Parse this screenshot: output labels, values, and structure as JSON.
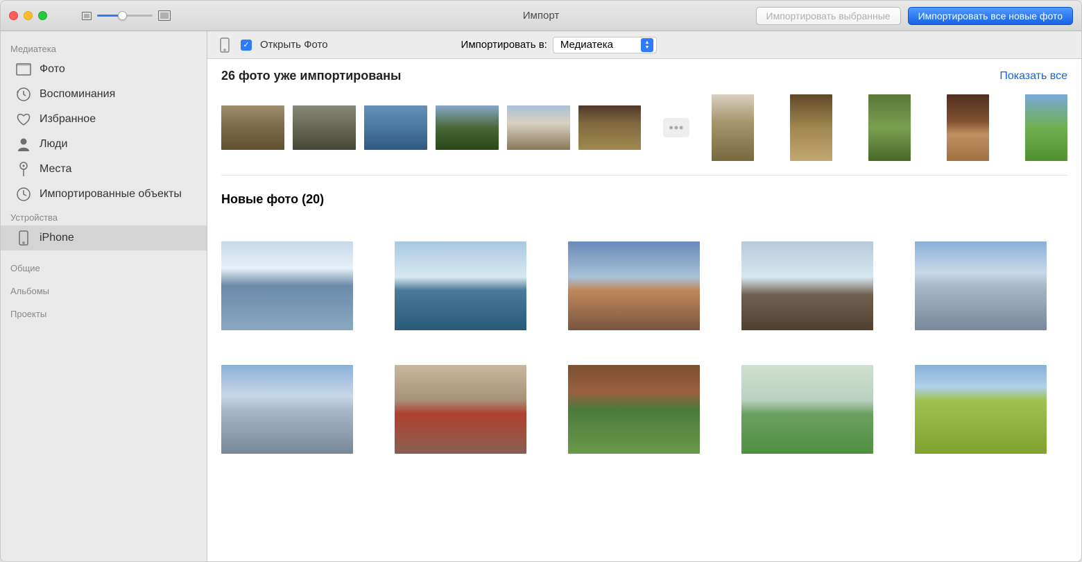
{
  "window": {
    "title": "Импорт"
  },
  "toolbar": {
    "import_selected_label": "Импортировать выбранные",
    "import_all_label": "Импортировать все новые фото"
  },
  "sidebar": {
    "sections": {
      "library": "Медиатека",
      "devices": "Устройства",
      "shared": "Общие",
      "albums": "Альбомы",
      "projects": "Проекты"
    },
    "items": {
      "photos": "Фото",
      "memories": "Воспоминания",
      "favorites": "Избранное",
      "people": "Люди",
      "places": "Места",
      "imports": "Импортированные объекты",
      "iphone": "iPhone"
    }
  },
  "import_bar": {
    "open_photos_label": "Открыть Фото",
    "import_to_label": "Импортировать в:",
    "destination": "Медиатека"
  },
  "already_imported": {
    "title": "26 фото уже импортированы",
    "show_all": "Показать все"
  },
  "new_photos": {
    "title": "Новые фото (20)"
  }
}
